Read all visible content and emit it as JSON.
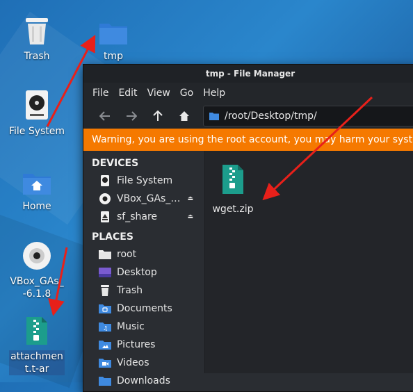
{
  "desktop": {
    "icons": [
      {
        "label": "Trash"
      },
      {
        "label": "tmp"
      },
      {
        "label": "File System"
      },
      {
        "label": "Home"
      },
      {
        "label": "VBox_GAs_-6.1.8"
      },
      {
        "label": "attachment.t-ar"
      }
    ]
  },
  "window": {
    "title": "tmp - File Manager",
    "menu": [
      "File",
      "Edit",
      "View",
      "Go",
      "Help"
    ],
    "path": "/root/Desktop/tmp/",
    "warning": "Warning, you are using the root account, you may harm your system."
  },
  "sidebar": {
    "devices_heading": "DEVICES",
    "devices": [
      {
        "label": "File System"
      },
      {
        "label": "VBox_GAs_…"
      },
      {
        "label": "sf_share"
      }
    ],
    "places_heading": "PLACES",
    "places": [
      {
        "label": "root"
      },
      {
        "label": "Desktop"
      },
      {
        "label": "Trash"
      },
      {
        "label": "Documents"
      },
      {
        "label": "Music"
      },
      {
        "label": "Pictures"
      },
      {
        "label": "Videos"
      },
      {
        "label": "Downloads"
      }
    ]
  },
  "files": [
    {
      "name": "wget.zip"
    }
  ],
  "colors": {
    "accent": "#f57900",
    "folder": "#3f8ae0",
    "arrow": "#e8201a"
  }
}
